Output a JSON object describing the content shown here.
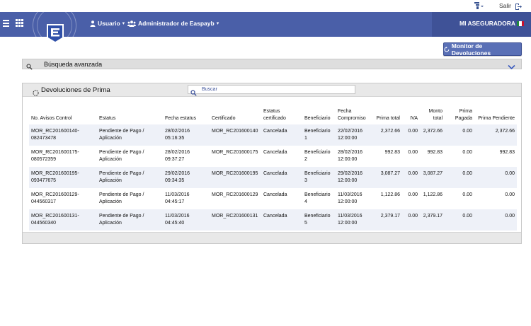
{
  "topbar": {
    "salir_label": "Salir"
  },
  "header": {
    "nav": [
      {
        "label": "Usuario"
      },
      {
        "label": "Administrador de Easpayb"
      }
    ],
    "company": "MI ASEGURADORA",
    "colors": {
      "primary": "#4a5fa8",
      "dark": "#3f5297"
    }
  },
  "monitor_button": {
    "label": "Monitor de Devoluciones"
  },
  "advanced_search": {
    "label": "Búsqueda avanzada"
  },
  "panel": {
    "title": "Devoluciones de Prima",
    "search_placeholder": "Buscar"
  },
  "table": {
    "headers": [
      "No. Avisos Control",
      "Estatus",
      "Fecha estatus",
      "Certificado",
      "Estatus certificado",
      "Beneficiario",
      "Fecha Compromiso",
      "Prima total",
      "IVA",
      "Monto total",
      "Prima Pagada",
      "Prima Pendiente"
    ],
    "rows": [
      [
        "MOR_RC201600140-082473478",
        "Pendiente de Pago / Aplicación",
        "28/02/2016 05:16:35",
        "MOR_RC201600140",
        "Cancelada",
        "Beneficiario 1",
        "22/02/2016 12:00:00",
        "2,372.66",
        "0.00",
        "2,372.66",
        "0.00",
        "2,372.66"
      ],
      [
        "MOR_RC201600175-080572359",
        "Pendiente de Pago / Aplicación",
        "28/02/2016 09:37:27",
        "MOR_RC201600175",
        "Cancelada",
        "Beneficiario 2",
        "28/02/2016 12:00:00",
        "992.83",
        "0.00",
        "992.83",
        "0.00",
        "992.83"
      ],
      [
        "MOR_RC201600195-093477675",
        "Pendiente de Pago / Aplicación",
        "29/02/2016 09:34:35",
        "MOR_RC201600195",
        "Cancelada",
        "Beneficiario 3",
        "29/02/2016 12:00:00",
        "3,087.27",
        "0.00",
        "3,087.27",
        "0.00",
        "0.00"
      ],
      [
        "MOR_RC201600129-044560317",
        "Pendiente de Pago / Aplicación",
        "11/03/2016 04:45:17",
        "MOR_RC201600129",
        "Cancelada",
        "Beneficiario 4",
        "11/03/2016 12:00:00",
        "1,122.86",
        "0.00",
        "1,122.86",
        "0.00",
        "0.00"
      ],
      [
        "MOR_RC201600131-044560340",
        "Pendiente de Pago / Aplicación",
        "11/03/2016 04:45:40",
        "MOR_RC201600131",
        "Cancelada",
        "Beneficiario 5",
        "11/03/2016 12:00:00",
        "2,379.17",
        "0.00",
        "2,379.17",
        "0.00",
        "0.00"
      ]
    ]
  }
}
